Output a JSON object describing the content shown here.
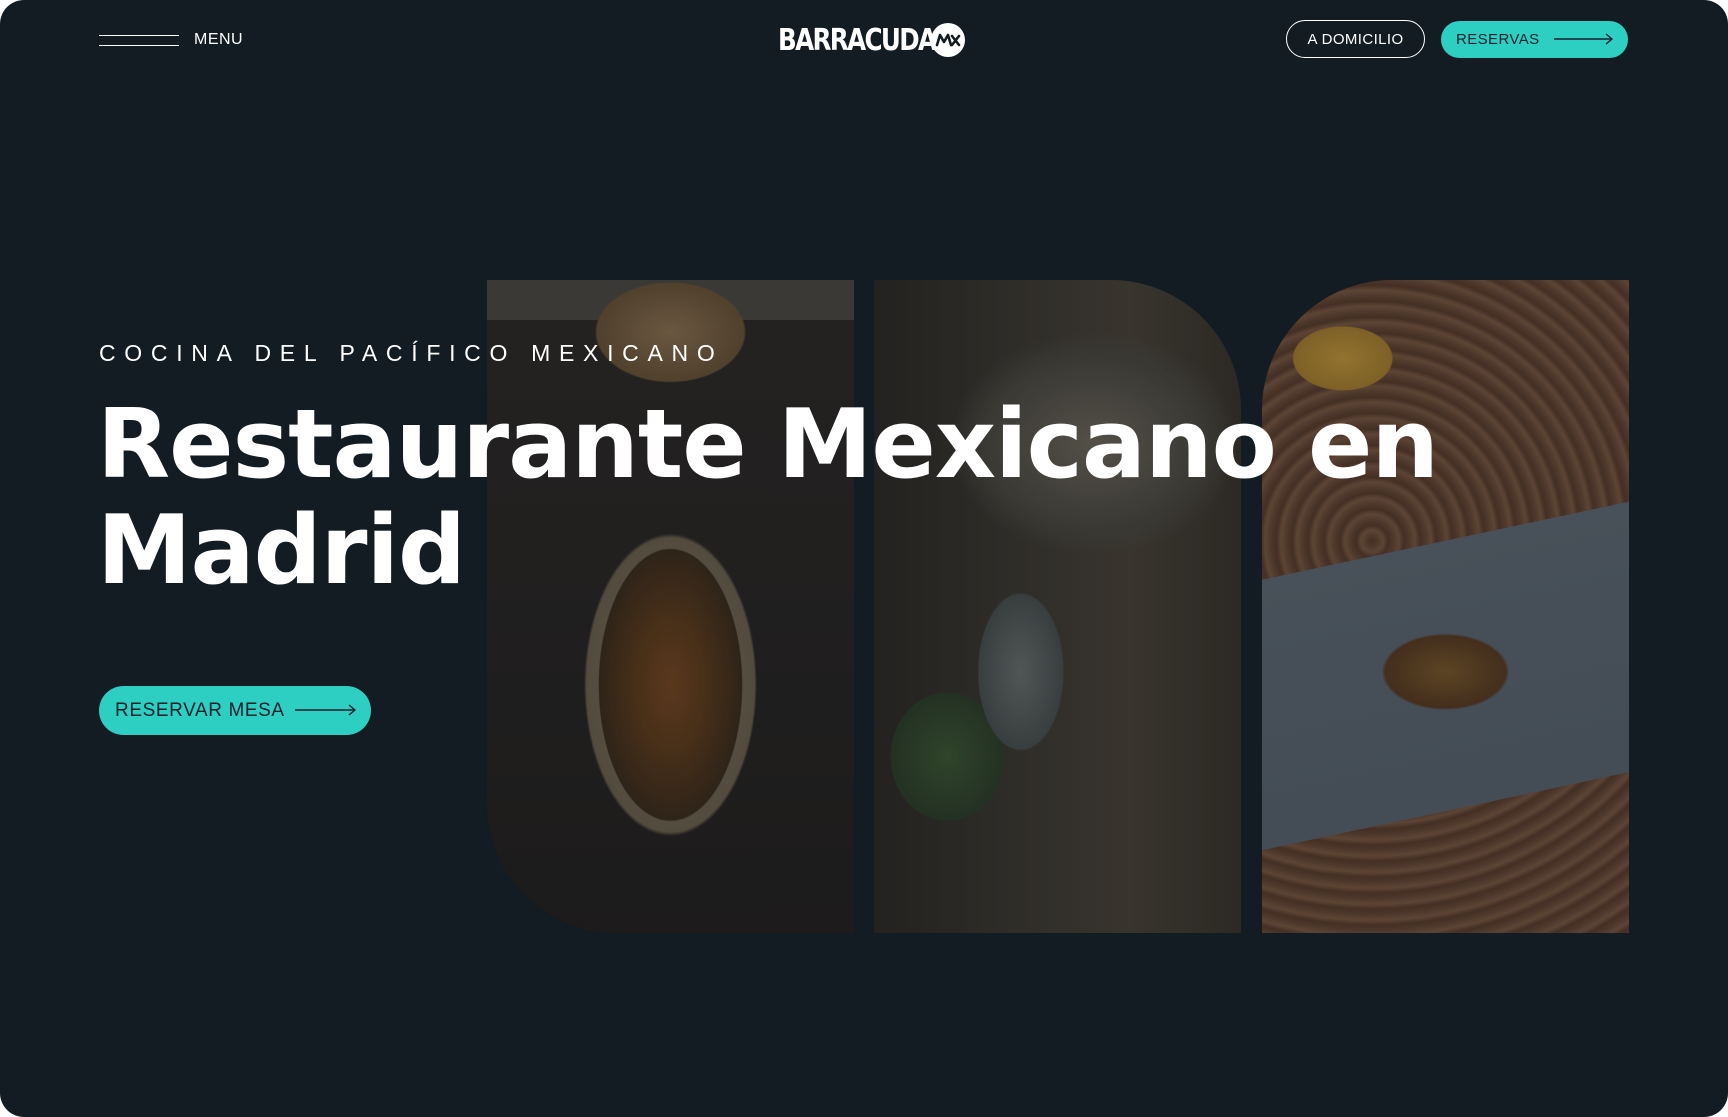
{
  "header": {
    "menu_label": "MENU",
    "logo_text": "BARRACUDA",
    "logo_badge_text": "MX",
    "delivery_label": "A DOMICILIO",
    "reservations_label": "RESERVAS"
  },
  "hero": {
    "eyebrow": "COCINA DEL PACÍFICO MEXICANO",
    "title": "Restaurante Mexicano en Madrid",
    "cta_label": "RESERVAR MESA"
  },
  "colors": {
    "background": "#121c22",
    "accent": "#2ccfc2",
    "text": "#ffffff",
    "button_text": "#10212a"
  },
  "icons": {
    "menu": "hamburger-icon",
    "arrow": "arrow-right-icon",
    "logo": "mx-badge-icon"
  }
}
